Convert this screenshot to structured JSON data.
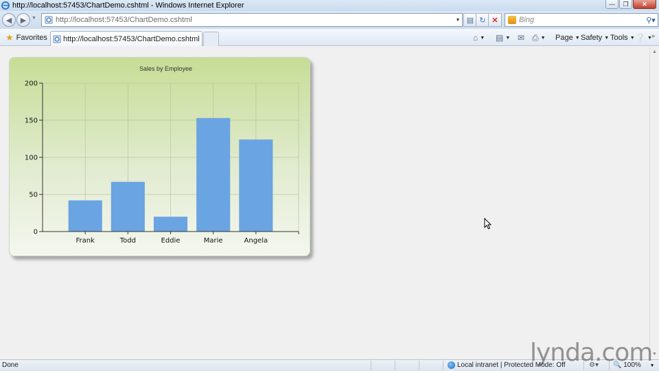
{
  "window": {
    "title": "http://localhost:57453/ChartDemo.cshtml - Windows Internet Explorer"
  },
  "address_bar": {
    "url": "http://localhost:57453/ChartDemo.cshtml"
  },
  "search": {
    "placeholder": "Bing"
  },
  "command_bar": {
    "favorites_label": "Favorites",
    "tab_label": "http://localhost:57453/ChartDemo.cshtml",
    "page_label": "Page",
    "safety_label": "Safety",
    "tools_label": "Tools"
  },
  "status": {
    "text": "Done",
    "zone": "Local intranet | Protected Mode: Off",
    "zoom": "100%"
  },
  "watermark": "lynda.com",
  "chart_data": {
    "type": "bar",
    "title": "Sales by Employee",
    "categories": [
      "Frank",
      "Todd",
      "Eddie",
      "Marie",
      "Angela"
    ],
    "values": [
      42,
      67,
      20,
      153,
      124
    ],
    "ylim": [
      0,
      200
    ],
    "yticks": [
      0,
      50,
      100,
      150,
      200
    ],
    "grid": true,
    "bar_color": "#6aa4e3"
  }
}
